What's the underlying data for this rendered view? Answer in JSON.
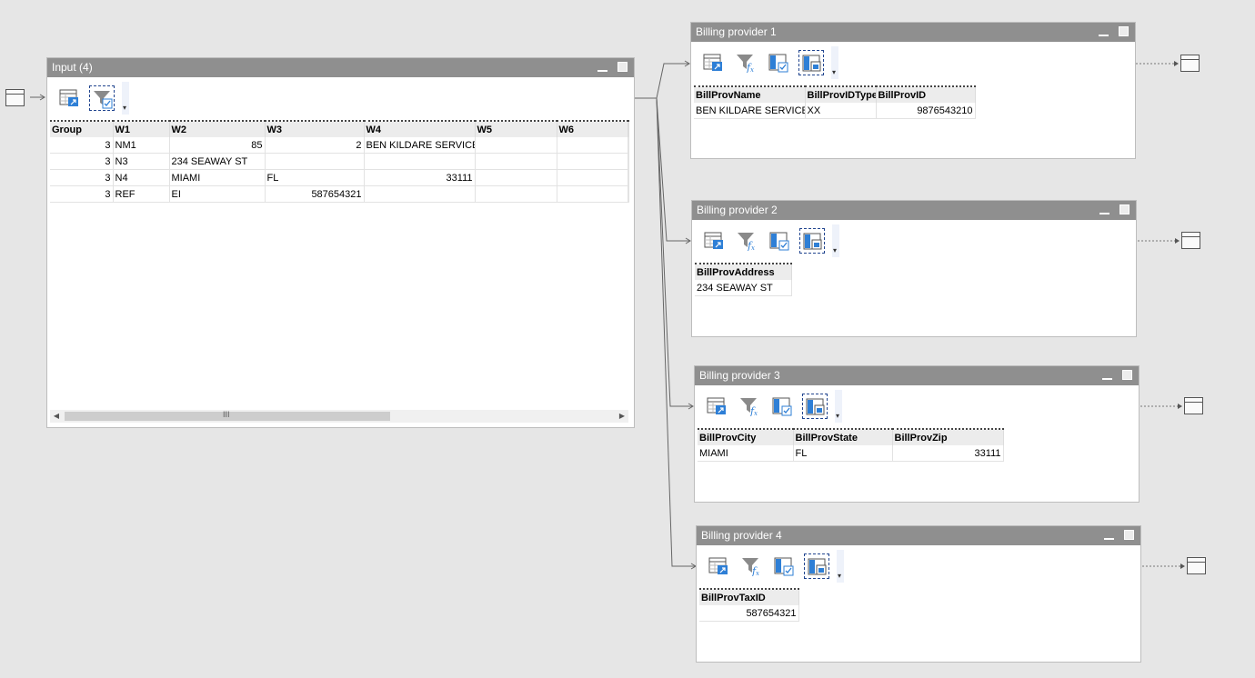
{
  "colors": {
    "background": "#e6e6e6",
    "titlebar": "#8f8f8f",
    "selection_border": "#21458f",
    "icon_blue": "#2e7fd6",
    "header_bg": "#ececec"
  },
  "input": {
    "title": "Input (4)",
    "tools": [
      "table-export-icon",
      "filter-check-icon"
    ],
    "columns": [
      "Group",
      "W1",
      "W2",
      "W3",
      "W4",
      "W5",
      "W6",
      ""
    ],
    "rows": [
      [
        "3",
        "NM1",
        "85",
        "2",
        "BEN KILDARE SERVICE",
        "",
        "",
        ""
      ],
      [
        "3",
        "N3",
        "234 SEAWAY ST",
        "",
        "",
        "",
        "",
        ""
      ],
      [
        "3",
        "N4",
        "MIAMI",
        "FL",
        "33111",
        "",
        "",
        ""
      ],
      [
        "3",
        "REF",
        "EI",
        "587654321",
        "",
        "",
        "",
        ""
      ]
    ],
    "scroll_label": "III"
  },
  "providers": [
    {
      "title": "Billing provider 1",
      "columns": [
        "BillProvName",
        "BillProvIDType",
        "BillProvID"
      ],
      "rows": [
        [
          "BEN KILDARE SERVICE",
          "XX",
          "9876543210"
        ]
      ]
    },
    {
      "title": "Billing provider 2",
      "columns": [
        "BillProvAddress"
      ],
      "rows": [
        [
          "234 SEAWAY ST"
        ]
      ]
    },
    {
      "title": "Billing provider 3",
      "columns": [
        "BillProvCity",
        "BillProvState",
        "BillProvZip"
      ],
      "rows": [
        [
          "MIAMI",
          "FL",
          "33111"
        ]
      ]
    },
    {
      "title": "Billing provider 4",
      "columns": [
        "BillProvTaxID"
      ],
      "rows": [
        [
          "587654321"
        ]
      ]
    }
  ],
  "provider_tools": [
    "table-export-icon",
    "filter-function-icon",
    "column-check-icon",
    "column-layout-icon"
  ]
}
